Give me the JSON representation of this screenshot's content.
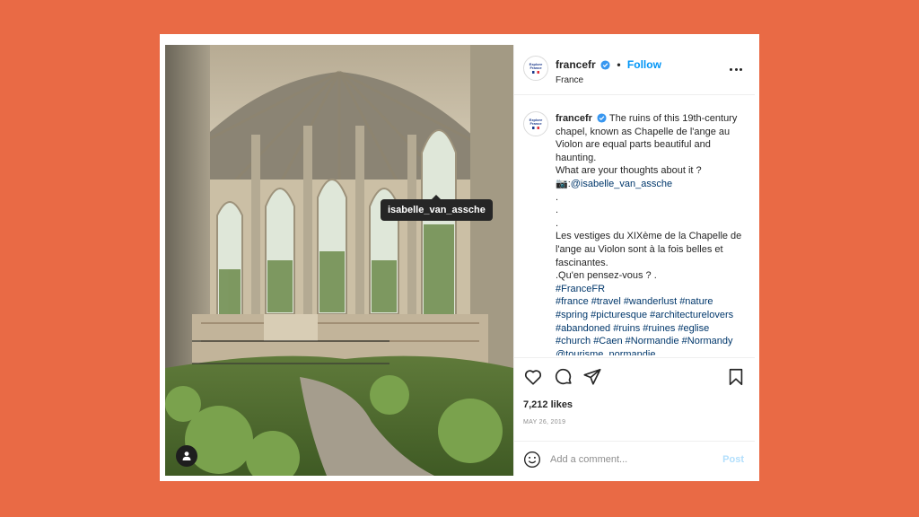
{
  "post": {
    "username": "francefr",
    "follow_label": "Follow",
    "dot": "•",
    "location": "France",
    "avatar_text": "Explore France",
    "photo_tag": "isabelle_van_assche",
    "caption_lines": [
      "The ruins of this 19th-century chapel, known as Chapelle de l'ange au Violon are equal parts beautiful and haunting.",
      "What are your thoughts about it ?",
      ".",
      ".",
      ".",
      "Les vestiges du XIXème de la Chapelle de l'ange au Violon sont à la fois belles et fascinantes.",
      ".Qu'en pensez-vous ? ."
    ],
    "photo_credit_prefix": ":",
    "photo_credit_handle": "@isabelle_van_assche",
    "hashtag_lines": [
      "#FranceFR",
      "#france #travel #wanderlust #nature",
      "#spring #picturesque #architecturelovers",
      "#abandoned #ruins #ruines #eglise",
      "#church #Caen #Normandie #Normandy",
      "@tourisme_normandie"
    ],
    "likes": "7,212 likes",
    "date": "MAY 26, 2019",
    "comment_placeholder": "Add a comment...",
    "post_label": "Post"
  },
  "icons": {
    "verified": "verified-badge-icon",
    "more": "more-options-icon",
    "like": "heart-icon",
    "comment": "comment-icon",
    "share": "paper-plane-icon",
    "save": "bookmark-icon",
    "emoji": "smiley-icon",
    "user_tag": "user-icon",
    "camera": "camera-icon"
  },
  "colors": {
    "background": "#e96a45",
    "link": "#00376b",
    "follow": "#0095f6",
    "post_disabled": "#b2dffc",
    "verified": "#3897f0"
  }
}
